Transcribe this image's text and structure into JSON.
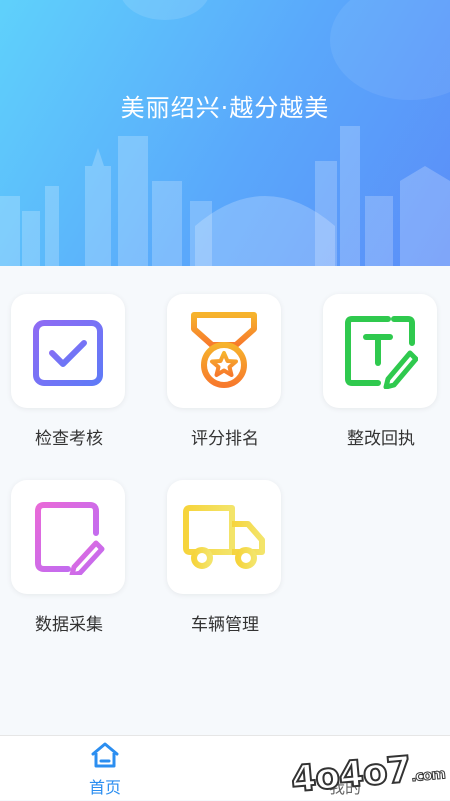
{
  "banner": {
    "title": "美丽绍兴·越分越美"
  },
  "menu": [
    {
      "label": "检查考核",
      "icon": "calendar-check-icon",
      "color": "#7b6cf6"
    },
    {
      "label": "评分排名",
      "icon": "medal-icon",
      "color": "#f79a2c"
    },
    {
      "label": "整改回执",
      "icon": "text-edit-icon",
      "color": "#2fc94e"
    },
    {
      "label": "数据采集",
      "icon": "document-edit-icon",
      "color": "#d96cf0"
    },
    {
      "label": "车辆管理",
      "icon": "truck-icon",
      "color": "#f5d445"
    }
  ],
  "tabbar": {
    "home_label": "首页",
    "mine_label": "我的",
    "active_color": "#2b8ef0"
  },
  "watermark": "4o4o7"
}
